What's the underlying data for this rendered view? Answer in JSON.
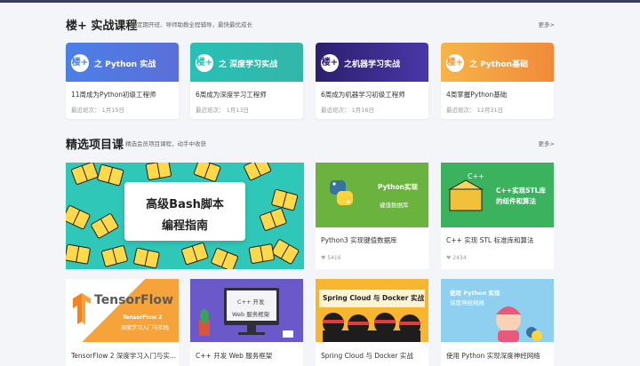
{
  "section1": {
    "title": "楼+ 实战课程",
    "subtitle": "定期开班、导师助教全程辅导，最快最优成长",
    "more": "更多>"
  },
  "courses": [
    {
      "logo": "楼+",
      "banner": "之 Python 实战",
      "title": "11周成为Python初级工程师",
      "meta": "最近班次：  1月15日"
    },
    {
      "logo": "楼+",
      "banner": "之 深度学习实战",
      "title": "6周成为深度学习工程师",
      "meta": "最近班次：  1月13日"
    },
    {
      "logo": "楼+",
      "banner": "之机器学习实战",
      "title": "6周成为机器学习初级工程师",
      "meta": "最近班次：  1月16日"
    },
    {
      "logo": "楼+",
      "banner": "之 Python基础",
      "title": "4周掌握Python基础",
      "meta": "最近班次：  12月31日"
    }
  ],
  "section2": {
    "title": "精选项目课",
    "subtitle": "精选会员项目课程，动手中收获",
    "more": "更多>"
  },
  "featured": {
    "line1": "高级Bash脚本",
    "line2": "编程指南"
  },
  "projects": [
    {
      "img_title": "Python实现",
      "img_sub": "键值数据库",
      "title": "Python3 实现键值数据库",
      "stat": "5416"
    },
    {
      "img_title": "C++实现STL库",
      "img_sub": "的组件和算法",
      "title": "C++ 实现 STL 标准库和算法",
      "stat": "2434"
    }
  ],
  "bottom": [
    {
      "img_brand": "TensorFlow",
      "img_l1": "TensorFlow 2",
      "img_l2": "深度学习入门与实践",
      "title": "TensorFlow 2 深度学习入门与实..."
    },
    {
      "img_l1": "C++ 开发",
      "img_l2": "Web 服务框架",
      "title": "C++ 开发 Web 服务框架"
    },
    {
      "img_l1": "Spring Cloud 与 Docker 实战",
      "title": "Spring Cloud 与 Docker 实战"
    },
    {
      "img_l1": "使用 Python 实现",
      "img_l2": "深度神经网络",
      "title": "使用 Python 实现深度神经网络"
    }
  ],
  "colors": {
    "accent": "#17a2b8",
    "course_banners": [
      "#4f7be3",
      "#2dbdb0",
      "#3b2a8c",
      "#f4a23b"
    ]
  }
}
